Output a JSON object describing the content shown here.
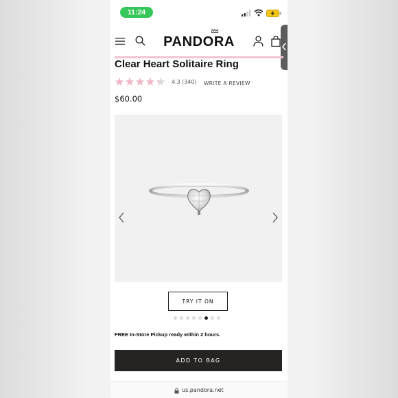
{
  "status_bar": {
    "time": "11:24"
  },
  "header": {
    "brand": "PANDORA"
  },
  "product": {
    "title": "Clear Heart Solitaire Ring",
    "rating_value": "4.3",
    "review_count": "(340)",
    "rating_fraction": 0.86,
    "write_review_label": "WRITE A REVIEW",
    "price": "$60.00"
  },
  "gallery": {
    "image_count": 8,
    "active_index": 5
  },
  "actions": {
    "try_on_label": "TRY IT ON",
    "pickup_note": "FREE In-Store Pickup ready within 2 hours.",
    "add_to_bag_label": "ADD TO BAG"
  },
  "browser": {
    "url": "us.pandora.net"
  },
  "colors": {
    "accent_pink": "#f2c4cf",
    "star_pink": "#f0b8c6",
    "status_green": "#35c75a",
    "button_dark": "#262423"
  },
  "icons": [
    "menu-icon",
    "search-icon",
    "account-icon",
    "bag-icon",
    "signal-icon",
    "wifi-icon",
    "battery-icon",
    "chevron-left-icon",
    "chevron-right-icon",
    "lock-icon",
    "star-icon"
  ]
}
